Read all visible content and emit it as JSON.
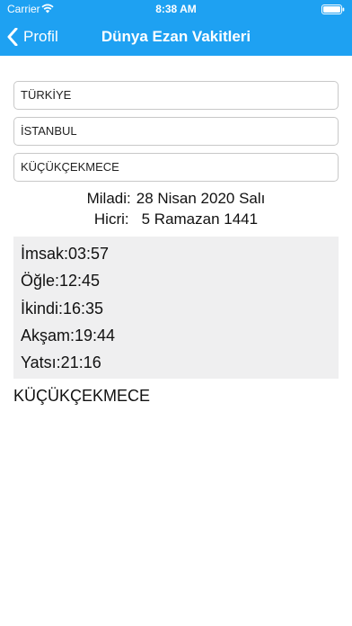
{
  "status_bar": {
    "carrier": "Carrier",
    "time": "8:38 AM",
    "wifi_icon": "wifi-icon",
    "battery_icon": "battery-icon"
  },
  "nav": {
    "back_label": "Profil",
    "back_icon": "chevron-left-icon",
    "title": "Dünya Ezan Vakitleri",
    "color": "#1ea1f2"
  },
  "location": {
    "country": "TÜRKİYE",
    "city": "İSTANBUL",
    "district": "KÜÇÜKÇEKMECE"
  },
  "dates": {
    "gregorian_label": "Miladi:",
    "gregorian_value": "28 Nisan 2020 Salı",
    "hijri_label": "Hicri:",
    "hijri_value": "5 Ramazan 1441"
  },
  "prayer_times": [
    "İmsak:03:57",
    "Öğle:12:45",
    "İkindi:16:35",
    "Akşam:19:44",
    "Yatsı:21:16"
  ],
  "footer_district": "KÜÇÜKÇEKMECE"
}
